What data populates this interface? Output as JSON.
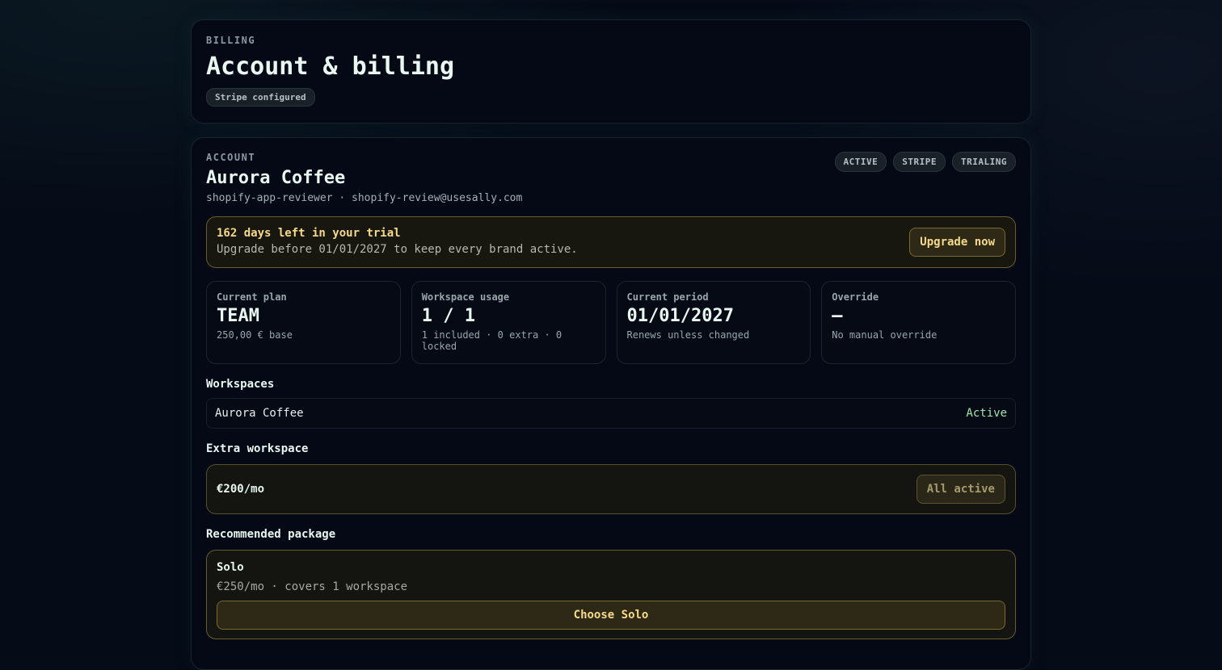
{
  "header": {
    "eyebrow": "BILLING",
    "title": "Account & billing",
    "stripe_pill": "Stripe configured"
  },
  "account": {
    "eyebrow": "ACCOUNT",
    "name": "Aurora Coffee",
    "meta": "shopify-app-reviewer · shopify-review@usesally.com",
    "badges": [
      "ACTIVE",
      "STRIPE",
      "TRIALING"
    ]
  },
  "trial": {
    "title": "162 days left in your trial",
    "subtitle": "Upgrade before 01/01/2027 to keep every brand active.",
    "upgrade_label": "Upgrade now"
  },
  "stats": [
    {
      "label": "Current plan",
      "value": "TEAM",
      "note": "250,00 € base"
    },
    {
      "label": "Workspace usage",
      "value": "1 / 1",
      "note": "1 included · 0 extra · 0 locked"
    },
    {
      "label": "Current period",
      "value": "01/01/2027",
      "note": "Renews unless changed"
    },
    {
      "label": "Override",
      "value": "—",
      "note": "No manual override"
    }
  ],
  "workspaces": {
    "title": "Workspaces",
    "items": [
      {
        "name": "Aurora Coffee",
        "status": "Active"
      }
    ]
  },
  "extra_workspace": {
    "title": "Extra workspace",
    "price": "€200/mo",
    "button_label": "All active"
  },
  "recommended": {
    "title": "Recommended package",
    "name": "Solo",
    "description": "€250/mo · covers 1 workspace",
    "button_label": "Choose Solo"
  },
  "colors": {
    "accent_gold": "#f6d98a",
    "active_green": "#9ee6b0",
    "background": "#050b17"
  }
}
